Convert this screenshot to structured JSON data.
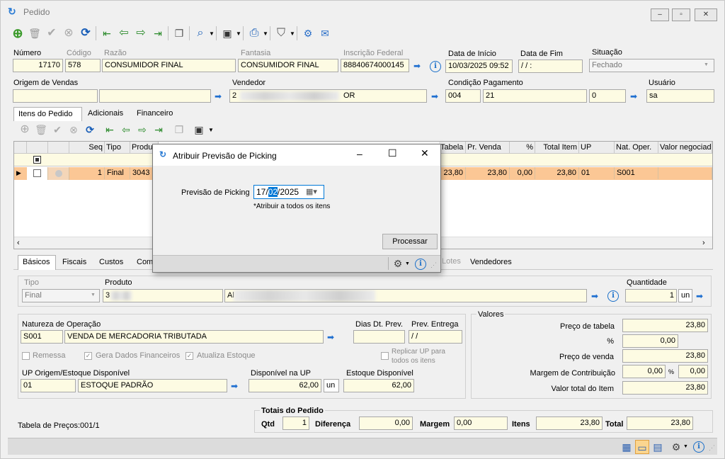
{
  "window": {
    "title": "Pedido",
    "minimize": "▭",
    "restore": "▣",
    "close": "✕"
  },
  "toolbar": {
    "icons": [
      "add-icon",
      "delete-icon",
      "confirm-icon",
      "cancel-icon",
      "refresh-icon",
      "first-icon",
      "prev-icon",
      "next-icon",
      "last-icon",
      "copy-icon",
      "search-icon",
      "options-icon",
      "print-icon",
      "filter-icon",
      "tools-icon",
      "send-icon"
    ]
  },
  "header": {
    "numero": {
      "label": "Número",
      "value": "17170"
    },
    "codigo": {
      "label": "Código",
      "value": "578"
    },
    "razao": {
      "label": "Razão",
      "value": "CONSUMIDOR FINAL"
    },
    "fantasia": {
      "label": "Fantasia",
      "value": "CONSUMIDOR FINAL"
    },
    "inscricao": {
      "label": "Inscrição Federal",
      "value": "88840674000145"
    },
    "data_inicio": {
      "label": "Data de Início",
      "value": "10/03/2025 09:52"
    },
    "data_fim": {
      "label": "Data de Fim",
      "value": "/ /  :"
    },
    "situacao": {
      "label": "Situação",
      "value": "Fechado"
    },
    "origem": {
      "label": "Origem de Vendas"
    },
    "vendedor": {
      "label": "Vendedor",
      "code": "2",
      "name_tail": "OR"
    },
    "condicao": {
      "label": "Condição Pagamento",
      "code": "004",
      "value": "21",
      "extra": "0"
    },
    "usuario": {
      "label": "Usuário",
      "value": "sa"
    }
  },
  "main_tabs": [
    "Itens do Pedido",
    "Adicionais",
    "Financeiro"
  ],
  "grid": {
    "columns": [
      "Seq",
      "Tipo",
      "Produ",
      "Tabela",
      "Pr. Venda",
      "%",
      "Total Item",
      "UP",
      "Nat. Oper.",
      "Valor negociad"
    ],
    "row": {
      "seq": "1",
      "tipo": "Final",
      "produto": "3043",
      "tabela": "23,80",
      "pr_venda": "23,80",
      "pct": "0,00",
      "total": "23,80",
      "up": "01",
      "nat": "S001"
    }
  },
  "dialog": {
    "title": "Atribuir Previsão de Picking",
    "field_label": "Previsão de Picking",
    "date_day": "17/",
    "date_month": "02",
    "date_year": "/2025",
    "note": "*Atribuir a todos os itens",
    "process_button": "Processar",
    "behind_tab": "Lotes"
  },
  "detail_tabs": [
    "Básicos",
    "Fiscais",
    "Custos",
    "Com",
    "Vendedores"
  ],
  "basicos": {
    "tipo": {
      "label": "Tipo",
      "value": "Final"
    },
    "produto": {
      "label": "Produto",
      "code": "3",
      "desc": "Al"
    },
    "quantidade": {
      "label": "Quantidade",
      "value": "1",
      "unit": "un"
    },
    "natureza": {
      "label": "Natureza de Operação",
      "code": "S001",
      "desc": "VENDA DE MERCADORIA TRIBUTADA"
    },
    "dias_prev": {
      "label": "Dias Dt. Prev."
    },
    "prev_entrega": {
      "label": "Prev. Entrega",
      "value": "/ /"
    },
    "remessa": "Remessa",
    "gera_fin": "Gera Dados Financeiros",
    "atualiza": "Atualiza Estoque",
    "replicar": "Replicar UP para todos os itens",
    "up_origem": {
      "label": "UP Origem/Estoque Disponível",
      "code": "01",
      "desc": "ESTOQUE PADRÃO"
    },
    "disp_up": {
      "label": "Disponível na UP",
      "value": "62,00",
      "unit": "un"
    },
    "estoque": {
      "label": "Estoque Disponível",
      "value": "62,00"
    }
  },
  "valores": {
    "title": "Valores",
    "preco_tabela": {
      "label": "Preço de tabela",
      "value": "23,80"
    },
    "pct": {
      "label": "%",
      "value": "0,00"
    },
    "preco_venda": {
      "label": "Preço de venda",
      "value": "23,80"
    },
    "margem": {
      "label": "Margem de Contribuição",
      "value": "0,00",
      "pct_label": "%",
      "pct_value": "0,00"
    },
    "valor_total": {
      "label": "Valor total do Item",
      "value": "23,80"
    }
  },
  "footer": {
    "tabela": "Tabela de Preços:001/1",
    "totais_title": "Totais do Pedido",
    "qtd": {
      "label": "Qtd",
      "value": "1"
    },
    "diferenca": {
      "label": "Diferença",
      "value": "0,00"
    },
    "margem": {
      "label": "Margem",
      "value": "0,00"
    },
    "itens": {
      "label": "Itens",
      "value": "23,80"
    },
    "total": {
      "label": "Total",
      "value": "23,80"
    }
  }
}
